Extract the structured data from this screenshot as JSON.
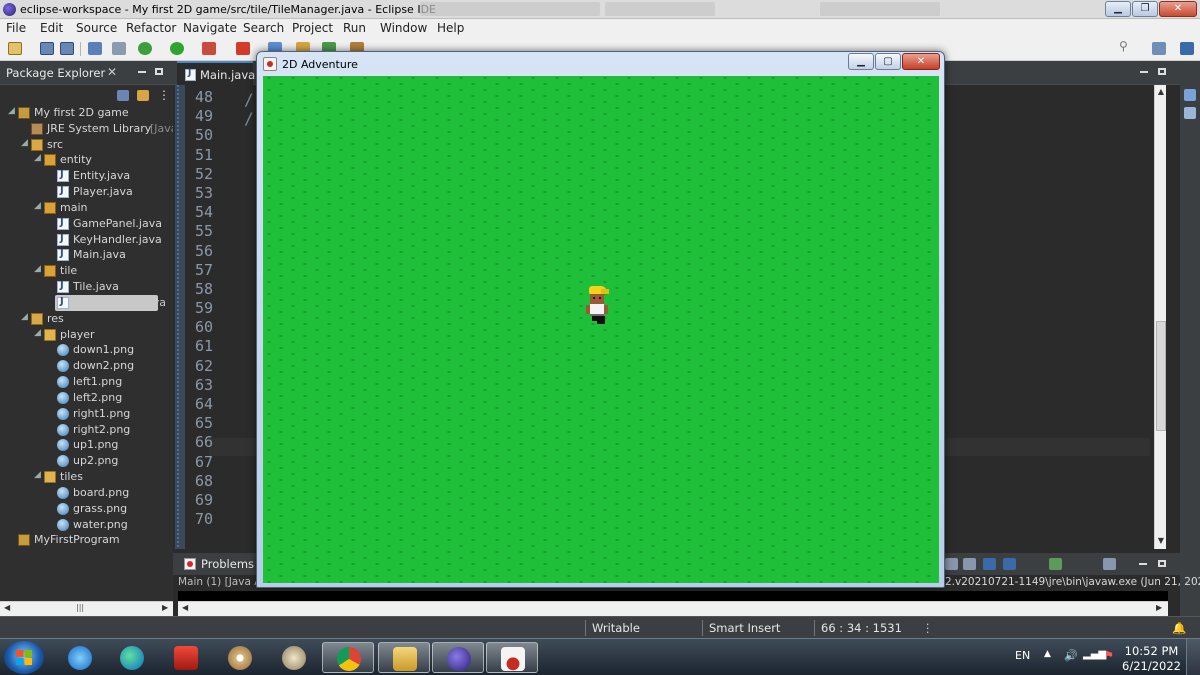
{
  "window": {
    "title": "eclipse-workspace - My first 2D game/src/tile/TileManager.java - Eclipse IDE"
  },
  "menu": [
    "File",
    "Edit",
    "Source",
    "Refactor",
    "Navigate",
    "Search",
    "Project",
    "Run",
    "Window",
    "Help"
  ],
  "package_explorer": {
    "tab_label": "Package Explorer",
    "tree": [
      {
        "label": "My first 2D game",
        "icon": "project-icon",
        "depth": 0
      },
      {
        "label": "JRE System Library",
        "suffix": "[JavaSE-",
        "icon": "library-icon",
        "depth": 1
      },
      {
        "label": "src",
        "icon": "source-folder-icon",
        "depth": 1
      },
      {
        "label": "entity",
        "icon": "package-icon",
        "depth": 2
      },
      {
        "label": "Entity.java",
        "icon": "java-file-icon",
        "depth": 3
      },
      {
        "label": "Player.java",
        "icon": "java-file-icon",
        "depth": 3
      },
      {
        "label": "main",
        "icon": "package-icon",
        "depth": 2
      },
      {
        "label": "GamePanel.java",
        "icon": "java-file-icon",
        "depth": 3
      },
      {
        "label": "KeyHandler.java",
        "icon": "java-file-icon",
        "depth": 3
      },
      {
        "label": "Main.java",
        "icon": "java-file-icon",
        "depth": 3
      },
      {
        "label": "tile",
        "icon": "package-icon",
        "depth": 2
      },
      {
        "label": "Tile.java",
        "icon": "java-file-icon",
        "depth": 3
      },
      {
        "label": "TileManager.java",
        "icon": "java-file-icon",
        "depth": 3,
        "selected": true
      },
      {
        "label": "res",
        "icon": "resource-folder-icon",
        "depth": 1
      },
      {
        "label": "player",
        "icon": "folder-icon",
        "depth": 2
      },
      {
        "label": "down1.png",
        "icon": "image-file-icon",
        "depth": 3
      },
      {
        "label": "down2.png",
        "icon": "image-file-icon",
        "depth": 3
      },
      {
        "label": "left1.png",
        "icon": "image-file-icon",
        "depth": 3
      },
      {
        "label": "left2.png",
        "icon": "image-file-icon",
        "depth": 3
      },
      {
        "label": "right1.png",
        "icon": "image-file-icon",
        "depth": 3
      },
      {
        "label": "right2.png",
        "icon": "image-file-icon",
        "depth": 3
      },
      {
        "label": "up1.png",
        "icon": "image-file-icon",
        "depth": 3
      },
      {
        "label": "up2.png",
        "icon": "image-file-icon",
        "depth": 3
      },
      {
        "label": "tiles",
        "icon": "folder-icon",
        "depth": 2
      },
      {
        "label": "board.png",
        "icon": "image-file-icon",
        "depth": 3
      },
      {
        "label": "grass.png",
        "icon": "image-file-icon",
        "depth": 3
      },
      {
        "label": "water.png",
        "icon": "image-file-icon",
        "depth": 3
      },
      {
        "label": "MyFirstProgram",
        "icon": "project-icon",
        "depth": 0
      }
    ]
  },
  "editor": {
    "tab_label": "Main.java",
    "line_numbers": [
      "48",
      "49",
      "50",
      "51",
      "52",
      "53",
      "54",
      "55",
      "56",
      "57",
      "58",
      "59",
      "60",
      "61",
      "62",
      "63",
      "64",
      "65",
      "66",
      "67",
      "68",
      "69",
      "70"
    ],
    "comment_marks": [
      "/",
      "/"
    ]
  },
  "bottom_panel": {
    "problems_tab": "Problems",
    "console_left": "Main (1) [Java A",
    "console_right": "2.v20210721-1149\\jre\\bin\\javaw.exe  (Jun 21, 2022"
  },
  "status_bar": {
    "writable": "Writable",
    "insert_mode": "Smart Insert",
    "position": "66 : 34 : 1531"
  },
  "game_window": {
    "title": "2D Adventure",
    "grass_color": "#1fbf3a"
  },
  "taskbar": {
    "lang": "EN",
    "time": "10:52 PM",
    "date": "6/21/2022"
  },
  "colors": {
    "ide_dark": "#2b2b2b",
    "accent": "#4a88c7"
  }
}
